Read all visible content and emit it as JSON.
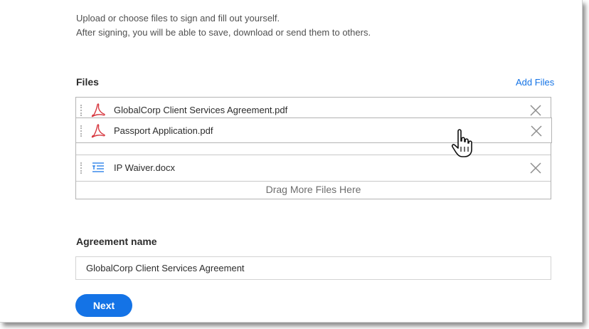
{
  "intro": {
    "line1": "Upload or choose files to sign and fill out yourself.",
    "line2": "After signing, you will be able to save, download or send them to others."
  },
  "files": {
    "label": "Files",
    "add_files_label": "Add Files",
    "items": [
      {
        "name": "GlobalCorp Client Services Agreement.pdf",
        "icon": "pdf-icon"
      },
      {
        "name": "Passport Application.pdf",
        "icon": "pdf-icon"
      },
      {
        "name": "IP Waiver.docx",
        "icon": "document-icon"
      }
    ],
    "drop_zone_text": "Drag More Files Here"
  },
  "agreement": {
    "label": "Agreement name",
    "value": "GlobalCorp Client Services Agreement"
  },
  "next_label": "Next",
  "colors": {
    "accent": "#1473e6",
    "pdf_red": "#d7373f"
  }
}
